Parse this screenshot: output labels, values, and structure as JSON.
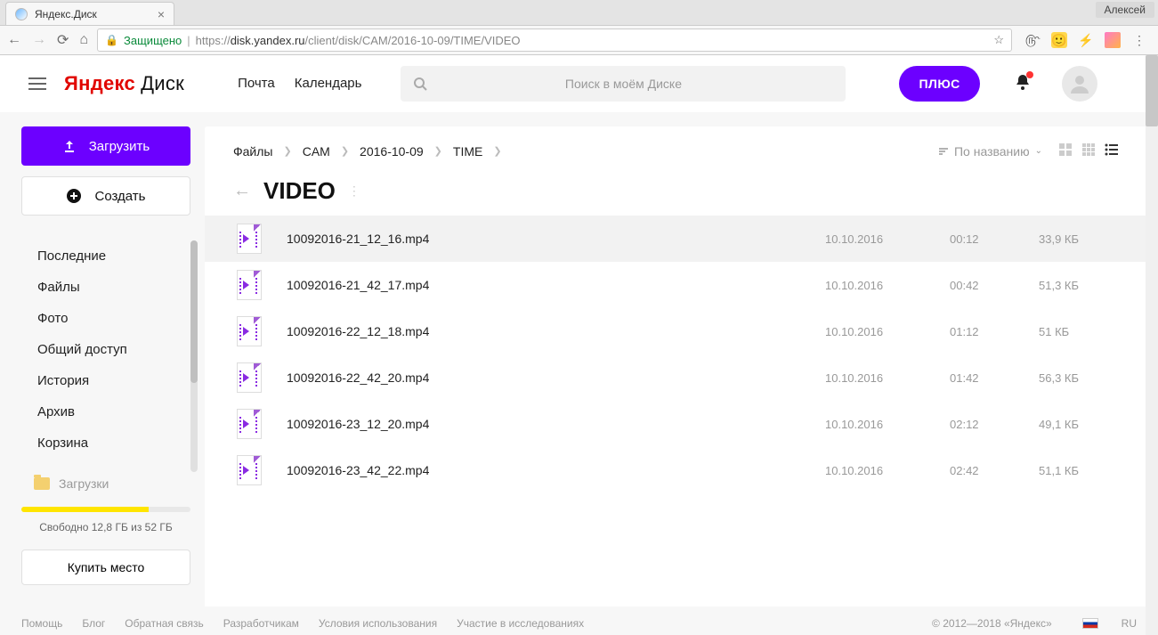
{
  "browser": {
    "tab_title": "Яндекс.Диск",
    "user_chip": "Алексей",
    "secure_label": "Защищено",
    "url_prefix": "https://",
    "url_host": "disk.yandex.ru",
    "url_path": "/client/disk/CAM/2016-10-09/TIME/VIDEO"
  },
  "header": {
    "logo_red": "Яндекс",
    "logo_thin": "Диск",
    "nav_mail": "Почта",
    "nav_calendar": "Календарь",
    "search_placeholder": "Поиск в моём Диске",
    "plus_label": "ПЛЮС"
  },
  "sidebar": {
    "upload_label": "Загрузить",
    "create_label": "Создать",
    "items": {
      "recent": "Последние",
      "files": "Файлы",
      "photo": "Фото",
      "shared": "Общий доступ",
      "history": "История",
      "archive": "Архив",
      "trash": "Корзина"
    },
    "folder_downloads": "Загрузки",
    "storage_text": "Свободно 12,8 ГБ из 52 ГБ",
    "buy_label": "Купить место"
  },
  "main": {
    "breadcrumbs": {
      "root": "Файлы",
      "b1": "CAM",
      "b2": "2016-10-09",
      "b3": "TIME"
    },
    "sort_label": "По названию",
    "folder_title": "VIDEO",
    "files": [
      {
        "name": "10092016-21_12_16.mp4",
        "date": "10.10.2016",
        "time": "00:12",
        "size": "33,9 КБ"
      },
      {
        "name": "10092016-21_42_17.mp4",
        "date": "10.10.2016",
        "time": "00:42",
        "size": "51,3 КБ"
      },
      {
        "name": "10092016-22_12_18.mp4",
        "date": "10.10.2016",
        "time": "01:12",
        "size": "51 КБ"
      },
      {
        "name": "10092016-22_42_20.mp4",
        "date": "10.10.2016",
        "time": "01:42",
        "size": "56,3 КБ"
      },
      {
        "name": "10092016-23_12_20.mp4",
        "date": "10.10.2016",
        "time": "02:12",
        "size": "49,1 КБ"
      },
      {
        "name": "10092016-23_42_22.mp4",
        "date": "10.10.2016",
        "time": "02:42",
        "size": "51,1 КБ"
      }
    ]
  },
  "footer": {
    "help": "Помощь",
    "blog": "Блог",
    "feedback": "Обратная связь",
    "devs": "Разработчикам",
    "terms": "Условия использования",
    "research": "Участие в исследованиях",
    "copyright": "© 2012—2018 «Яндекс»",
    "lang": "RU"
  }
}
